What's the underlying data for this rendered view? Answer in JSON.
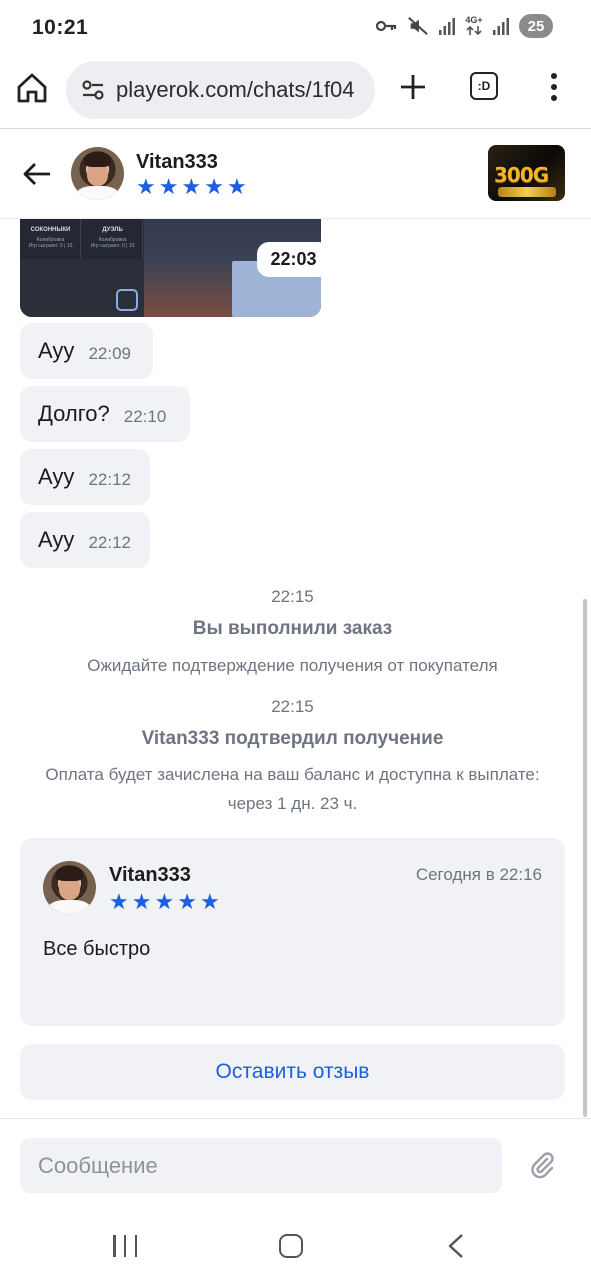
{
  "status_bar": {
    "time": "10:21",
    "network_label": "4G+",
    "battery": "25",
    "icons": [
      "key-icon",
      "mute-icon",
      "signal-icon",
      "network-4g-icon",
      "signal-icon",
      "battery-icon"
    ]
  },
  "browser": {
    "url": "playerok.com/chats/1f04",
    "tab_label": ":D",
    "icons": [
      "home-icon",
      "site-settings-icon",
      "plus-icon",
      "tab-switcher-icon",
      "more-vert-icon"
    ]
  },
  "chat_header": {
    "name": "Vitan333",
    "stars": [
      "★",
      "★",
      "★",
      "★",
      "★"
    ],
    "game_thumb_label": "300G"
  },
  "photo_message": {
    "time": "22:03",
    "cells": [
      {
        "title": "СОКОННЫКИ",
        "sub": "Колибровка\nИгр сыграно: 0 | 10"
      },
      {
        "title": "ДУЭЛЬ",
        "sub": "Колибровка\nИгр сыграно: 0 | 10"
      }
    ]
  },
  "messages": [
    {
      "text": "Ауу",
      "time": "22:09"
    },
    {
      "text": "Долго?",
      "time": "22:10"
    },
    {
      "text": "Ауу",
      "time": "22:12"
    },
    {
      "text": "Ауу",
      "time": "22:12"
    }
  ],
  "system_events": [
    {
      "time": "22:15",
      "title": "Вы выполнили заказ",
      "desc": "Ожидайте подтверждение получения от покупателя"
    },
    {
      "time": "22:15",
      "title": "Vitan333 подтвердил получение",
      "desc": "Оплата будет зачислена на ваш баланс и доступна к выплате: через 1 дн. 23 ч."
    }
  ],
  "review": {
    "name": "Vitan333",
    "date": "Сегодня в 22:16",
    "stars": [
      "★",
      "★",
      "★",
      "★",
      "★"
    ],
    "text": "Все быстро"
  },
  "leave_review_label": "Оставить отзыв",
  "input": {
    "placeholder": "Сообщение",
    "value": ""
  },
  "colors": {
    "accent": "#1d5fe0",
    "bubble_bg": "#f1f2f5",
    "muted_text": "#6e7480"
  }
}
